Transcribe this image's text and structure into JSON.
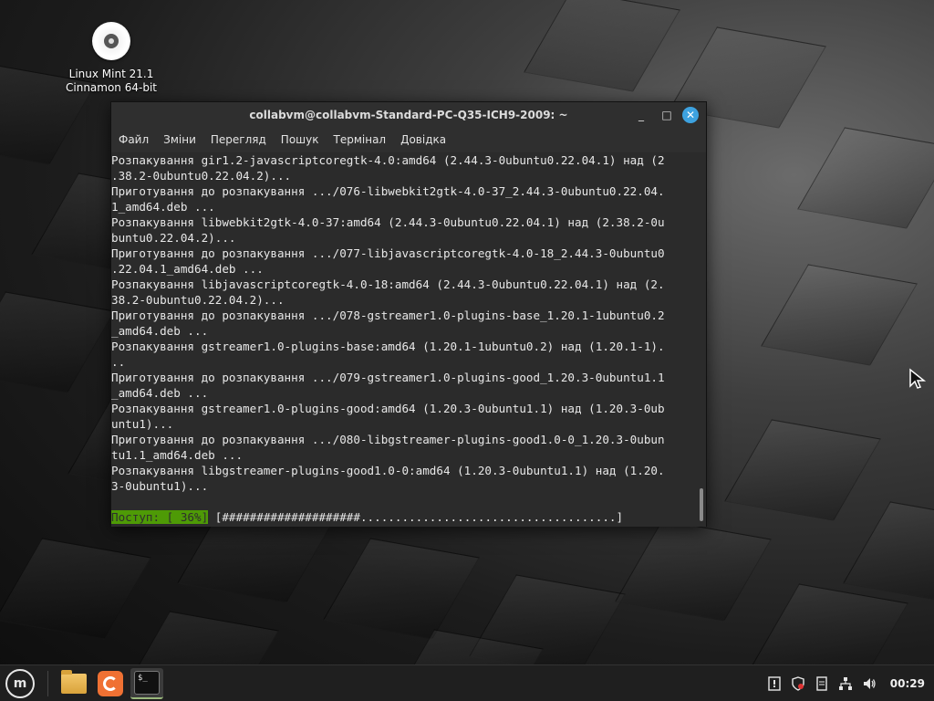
{
  "desktop": {
    "icon_label_line1": "Linux Mint 21.1",
    "icon_label_line2": "Cinnamon 64-bit"
  },
  "window": {
    "title": "collabvm@collabvm-Standard-PC-Q35-ICH9-2009: ~",
    "controls": {
      "minimize": "_",
      "maximize": "□",
      "close": "✕"
    },
    "menu": [
      "Файл",
      "Зміни",
      "Перегляд",
      "Пошук",
      "Термінал",
      "Довідка"
    ]
  },
  "terminal": {
    "lines": [
      "Розпакування gir1.2-javascriptcoregtk-4.0:amd64 (2.44.3-0ubuntu0.22.04.1) над (2",
      ".38.2-0ubuntu0.22.04.2)...",
      "Приготування до розпакування .../076-libwebkit2gtk-4.0-37_2.44.3-0ubuntu0.22.04.",
      "1_amd64.deb ...",
      "Розпакування libwebkit2gtk-4.0-37:amd64 (2.44.3-0ubuntu0.22.04.1) над (2.38.2-0u",
      "buntu0.22.04.2)...",
      "Приготування до розпакування .../077-libjavascriptcoregtk-4.0-18_2.44.3-0ubuntu0",
      ".22.04.1_amd64.deb ...",
      "Розпакування libjavascriptcoregtk-4.0-18:amd64 (2.44.3-0ubuntu0.22.04.1) над (2.",
      "38.2-0ubuntu0.22.04.2)...",
      "Приготування до розпакування .../078-gstreamer1.0-plugins-base_1.20.1-1ubuntu0.2",
      "_amd64.deb ...",
      "Розпакування gstreamer1.0-plugins-base:amd64 (1.20.1-1ubuntu0.2) над (1.20.1-1).",
      "..",
      "Приготування до розпакування .../079-gstreamer1.0-plugins-good_1.20.3-0ubuntu1.1",
      "_amd64.deb ...",
      "Розпакування gstreamer1.0-plugins-good:amd64 (1.20.3-0ubuntu1.1) над (1.20.3-0ub",
      "untu1)...",
      "Приготування до розпакування .../080-libgstreamer-plugins-good1.0-0_1.20.3-0ubun",
      "tu1.1_amd64.deb ...",
      "Розпакування libgstreamer-plugins-good1.0-0:amd64 (1.20.3-0ubuntu1.1) над (1.20.",
      "3-0ubuntu1)..."
    ],
    "progress_label": "Поступ: [ 36%]",
    "progress_bar": " [####################.....................................]",
    "progress_value": 0.36
  },
  "taskbar": {
    "menu_button_glyph": "m",
    "terminal_launcher_glyph": "$_",
    "tray_icons": [
      "update-manager-icon",
      "shield-icon",
      "notes-icon",
      "network-icon",
      "volume-icon"
    ],
    "clock": "00:29"
  },
  "colors": {
    "progress_bg": "#4e9a06",
    "close_button": "#3da2e0",
    "terminal_bg": "#2b2b2b"
  }
}
